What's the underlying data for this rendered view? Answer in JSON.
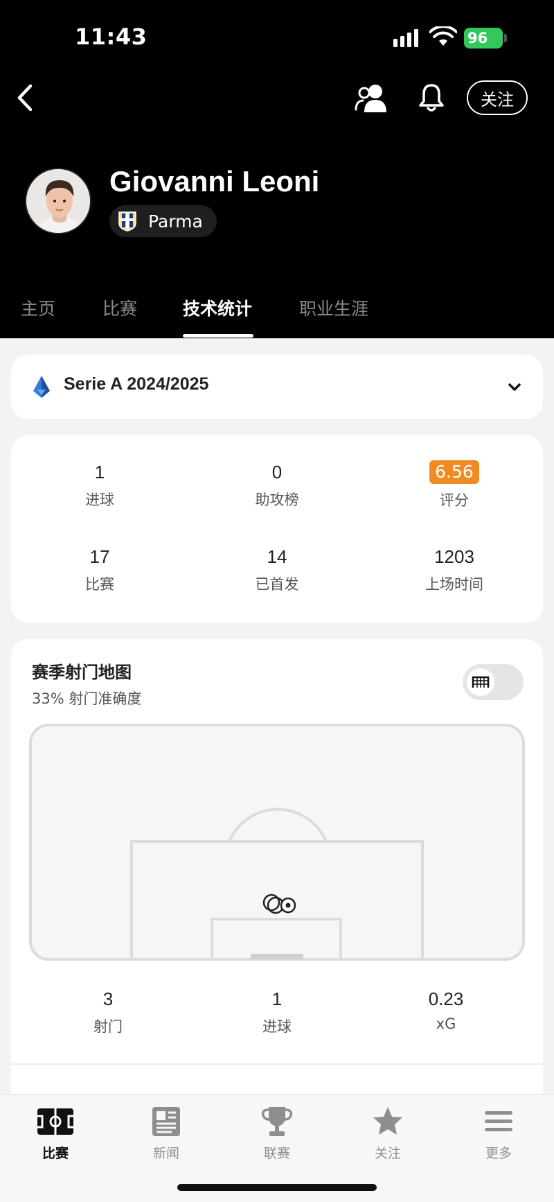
{
  "status_bar": {
    "time": "11:43",
    "battery": "96"
  },
  "header": {
    "follow_label": "关注",
    "player_name": "Giovanni Leoni",
    "club": "Parma"
  },
  "tabs": [
    {
      "label": "主页"
    },
    {
      "label": "比赛"
    },
    {
      "label": "技术统计",
      "active": true
    },
    {
      "label": "职业生涯"
    }
  ],
  "league": {
    "name": "Serie A 2024/2025"
  },
  "stats": [
    {
      "value": "1",
      "label": "进球"
    },
    {
      "value": "0",
      "label": "助攻榜"
    },
    {
      "value": "6.56",
      "label": "评分",
      "badge_color": "#f08a24"
    },
    {
      "value": "17",
      "label": "比赛"
    },
    {
      "value": "14",
      "label": "已首发"
    },
    {
      "value": "1203",
      "label": "上场时间"
    }
  ],
  "shot_map": {
    "title": "赛季射门地图",
    "accuracy": "33% 射门准确度",
    "stats": [
      {
        "value": "3",
        "label": "射门"
      },
      {
        "value": "1",
        "label": "进球"
      },
      {
        "value": "0.23",
        "label": "xG"
      }
    ]
  },
  "bottom_nav": [
    {
      "label": "比赛",
      "icon": "pitch-icon",
      "active": true
    },
    {
      "label": "新闻",
      "icon": "newspaper-icon"
    },
    {
      "label": "联赛",
      "icon": "trophy-icon"
    },
    {
      "label": "关注",
      "icon": "star-icon"
    },
    {
      "label": "更多",
      "icon": "menu-icon"
    }
  ],
  "colors": {
    "accent_rating": "#f08a24",
    "battery": "#34c759",
    "header_bg": "#000000"
  }
}
